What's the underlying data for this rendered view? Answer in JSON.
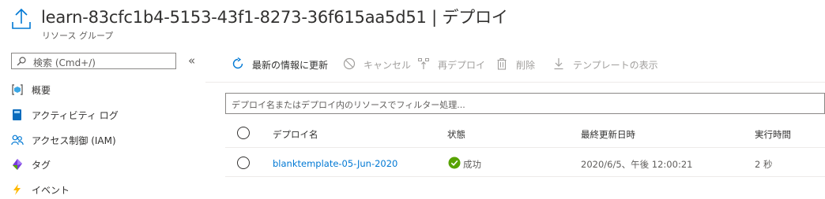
{
  "header": {
    "icon": "deploy-upload-icon",
    "title": "learn-83cfc1b4-5153-43f1-8273-36f615aa5d51 | デプロイ",
    "subtitle": "リソース グループ"
  },
  "sidebar": {
    "search_placeholder": "検索 (Cmd+/)",
    "collapse_label": "«",
    "items": [
      {
        "label": "概要",
        "icon": "resource-group-icon"
      },
      {
        "label": "アクティビティ ログ",
        "icon": "activity-log-icon"
      },
      {
        "label": "アクセス制御 (IAM)",
        "icon": "people-icon"
      },
      {
        "label": "タグ",
        "icon": "tag-icon"
      },
      {
        "label": "イベント",
        "icon": "lightning-icon"
      }
    ]
  },
  "toolbar": {
    "refresh": "最新の情報に更新",
    "cancel": "キャンセル",
    "redeploy": "再デプロイ",
    "delete": "削除",
    "view_template": "テンプレートの表示"
  },
  "filter": {
    "placeholder": "デプロイ名またはデプロイ内のリソースでフィルター処理..."
  },
  "table": {
    "columns": [
      "デプロイ名",
      "状態",
      "最終更新日時",
      "実行時間"
    ],
    "rows": [
      {
        "name": "blanktemplate-05-Jun-2020",
        "status": "成功",
        "last_modified": "2020/6/5、午後 12:00:21",
        "duration": "2 秒"
      }
    ]
  },
  "colors": {
    "accent": "#0078d4",
    "success": "#57a300",
    "disabled": "#a19f9d",
    "text": "#323130"
  }
}
